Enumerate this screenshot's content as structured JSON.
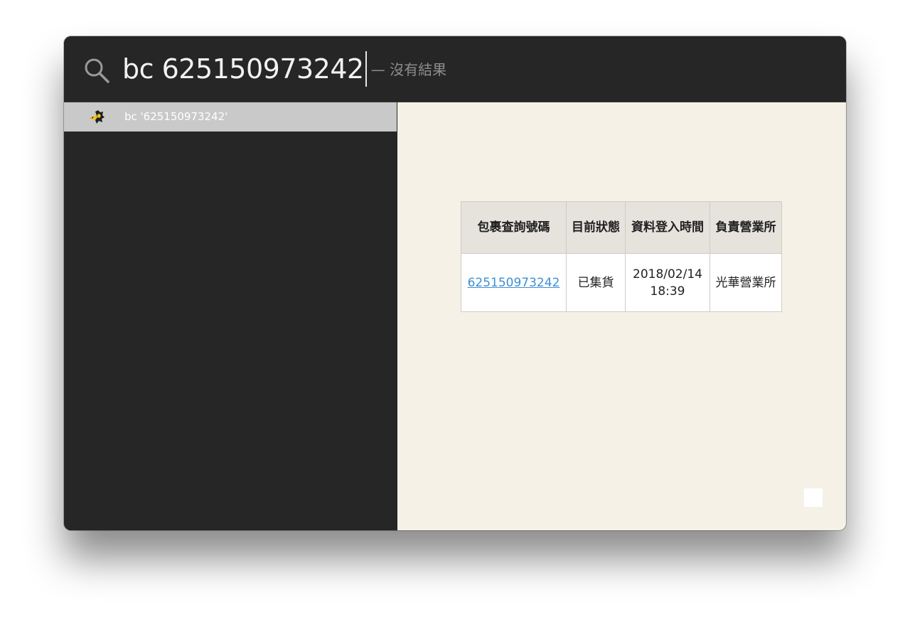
{
  "search": {
    "query": "bc 625150973242",
    "hint": "— 沒有結果",
    "icon": "search-icon"
  },
  "results": [
    {
      "label": "bc '625150973242'",
      "icon": "workflow-app-icon",
      "selected": true
    }
  ],
  "preview": {
    "table": {
      "headers": [
        "包裹查詢號碼",
        "目前狀態",
        "資料登入時間",
        "負責營業所"
      ],
      "rows": [
        {
          "tracking_number": "625150973242",
          "status": "已集貨",
          "login_time": "2018/02/14 18:39",
          "office": "光華營業所"
        }
      ]
    }
  },
  "colors": {
    "search_bg": "#262626",
    "selected_row_bg": "#c9c9c9",
    "preview_bg": "#f5f1e7",
    "link": "#3d8fd6"
  }
}
